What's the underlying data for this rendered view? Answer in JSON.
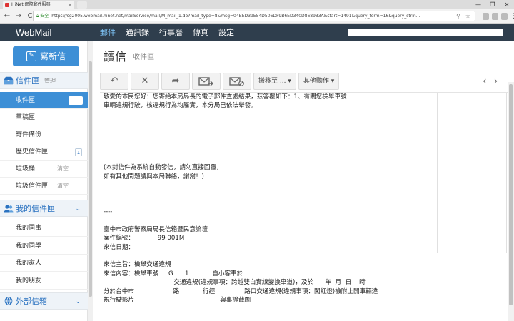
{
  "browser": {
    "tab_title": "HiNet 網際郵件服務",
    "tab_close": "×",
    "window_controls": [
      "—",
      "❐",
      "✕"
    ],
    "nav": {
      "back": "←",
      "forward": "→",
      "reload": "C"
    },
    "security_label": "安全",
    "url": "https://sg2005.webmail.hinet.net/mailService/mail/M_mail_1.do?mail_type=8&msg=04BED39E54D506DF9B6ED340D868933A&start=1491&query_form=16&query_strin..."
  },
  "header": {
    "logo": "WebMail",
    "nav_items": [
      {
        "label": "郵件",
        "active": true
      },
      {
        "label": "通訊錄",
        "active": false
      },
      {
        "label": "行事曆",
        "active": false
      },
      {
        "label": "傳真",
        "active": false
      },
      {
        "label": "設定",
        "active": false
      }
    ]
  },
  "sidebar": {
    "compose_label": "寫新信",
    "inbox_section": {
      "label": "信件匣",
      "manage": "管理"
    },
    "items": [
      {
        "label": "收件匣",
        "selected": true
      },
      {
        "label": "草稿匣"
      },
      {
        "label": "寄件備份"
      },
      {
        "label": "歷史信件匣",
        "badge": "1"
      },
      {
        "label": "垃圾桶",
        "sub": "清空"
      },
      {
        "label": "垃圾信件匣",
        "sub": "清空"
      }
    ],
    "my_section": {
      "label": "我的信件匣",
      "chevron": "⌄"
    },
    "my_items": [
      {
        "label": "我的同事"
      },
      {
        "label": "我的同學"
      },
      {
        "label": "我的家人"
      },
      {
        "label": "我的朋友"
      }
    ],
    "external_section": {
      "label": "外部信箱",
      "chevron": "⌄"
    }
  },
  "main": {
    "title": "讀信",
    "subtitle": "收件匣",
    "toolbar": {
      "reply_icon": "↶",
      "delete_icon": "✕",
      "forward_icon": "➦",
      "move_label": "搬移至 ... ▾",
      "other_label": "其他動作 ▾"
    },
    "pager": {
      "prev": "‹",
      "next": "›"
    },
    "body_lines": [
      "敬愛的市民您好：您寄給本局局長的電子郵件查處結果，茲答覆如下：1、有關您檢舉車號",
      "車輛違規行駛，核違規行為均屬實，本分局已依法舉發。",
      "",
      "",
      "",
      "",
      "",
      "",
      "(本封信件為系統自動發信，請勿直接回覆，",
      "如有其他問題請與本局聯絡，謝謝！)",
      "",
      "",
      "",
      "----",
      "",
      "臺中市政府警察局局長信箱暨民意論壇",
      "案件編號：            99 001M",
      "來信日期：",
      "",
      "來信主旨：檢舉交通違規",
      "來信內容：檢舉車號     G      1            自小客車於",
      "                                    交通違規(違規事項：跨越雙白實線變換車道)，及於      年  月  日    時",
      "分於台中市                    路            行經               路口交通違規(違規事項：闖紅燈)檢附上開車輛違",
      "規行駛影片                                            與事證截圖"
    ]
  }
}
